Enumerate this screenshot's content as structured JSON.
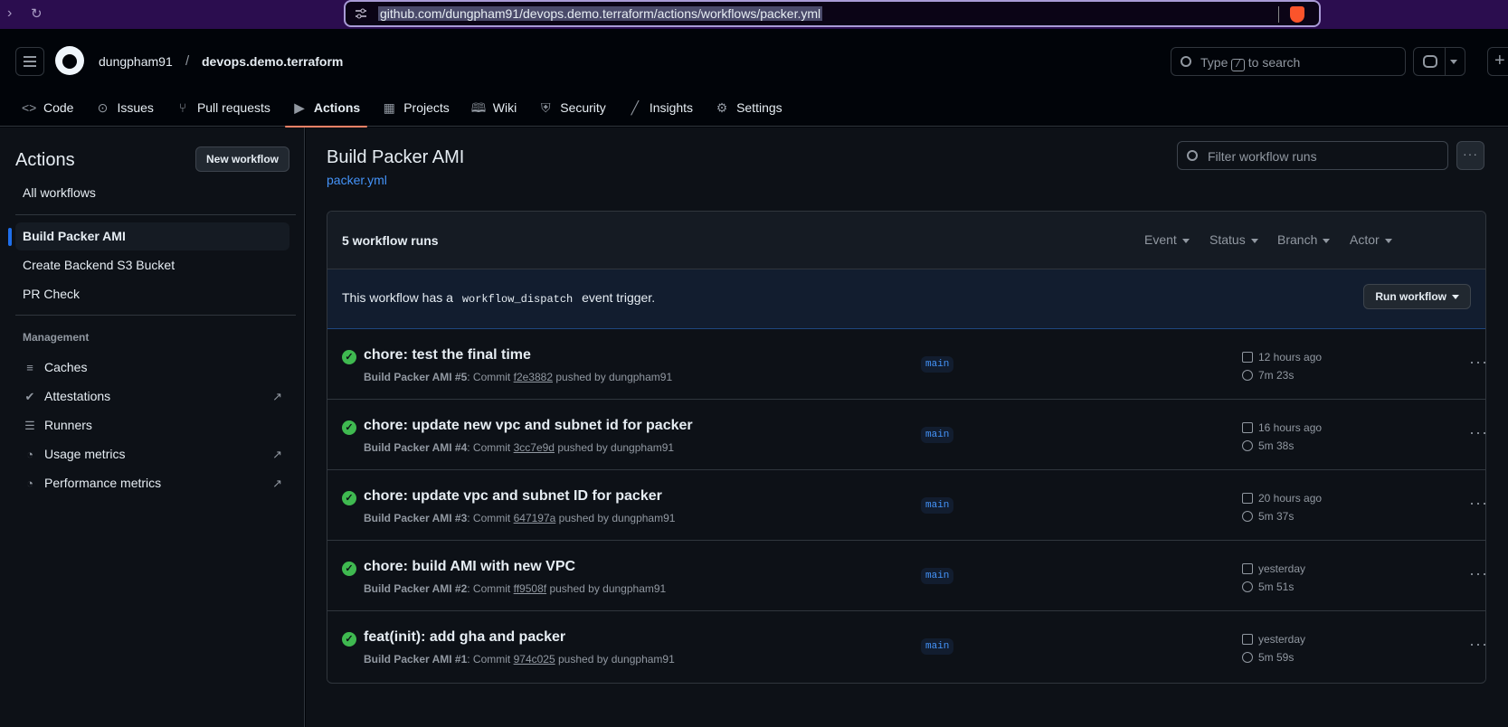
{
  "browser": {
    "url": "github.com/dungpham91/devops.demo.terraform/actions/workflows/packer.yml"
  },
  "header": {
    "owner": "dungpham91",
    "separator": "/",
    "repo": "devops.demo.terraform",
    "search_prefix": "Type",
    "search_key": "/",
    "search_suffix": "to search"
  },
  "tabs": [
    {
      "label": "Code",
      "icon": "code-icon"
    },
    {
      "label": "Issues",
      "icon": "issue-icon"
    },
    {
      "label": "Pull requests",
      "icon": "pull-request-icon"
    },
    {
      "label": "Actions",
      "icon": "play-icon",
      "active": true
    },
    {
      "label": "Projects",
      "icon": "table-icon"
    },
    {
      "label": "Wiki",
      "icon": "book-icon"
    },
    {
      "label": "Security",
      "icon": "shield-icon"
    },
    {
      "label": "Insights",
      "icon": "graph-icon"
    },
    {
      "label": "Settings",
      "icon": "gear-icon"
    }
  ],
  "sidebar": {
    "title": "Actions",
    "new_workflow": "New workflow",
    "all_workflows": "All workflows",
    "workflows": [
      "Build Packer AMI",
      "Create Backend S3 Bucket",
      "PR Check"
    ],
    "management_heading": "Management",
    "management": [
      {
        "label": "Caches",
        "icon": "database-icon",
        "external": false
      },
      {
        "label": "Attestations",
        "icon": "check-circle-icon",
        "external": true
      },
      {
        "label": "Runners",
        "icon": "server-icon",
        "external": false
      },
      {
        "label": "Usage metrics",
        "icon": "meter-icon",
        "external": true
      },
      {
        "label": "Performance metrics",
        "icon": "meter-icon",
        "external": true
      }
    ]
  },
  "main": {
    "title": "Build Packer AMI",
    "file": "packer.yml",
    "filter_placeholder": "Filter workflow runs",
    "run_count": "5 workflow runs",
    "filters": [
      "Event",
      "Status",
      "Branch",
      "Actor"
    ],
    "dispatch_prefix": "This workflow has a",
    "dispatch_code": "workflow_dispatch",
    "dispatch_suffix": "event trigger.",
    "run_workflow": "Run workflow",
    "runs": [
      {
        "title": "chore: test the final time",
        "workflow": "Build Packer AMI #5",
        "commit_label": ": Commit",
        "sha": "f2e3882",
        "pushed": "pushed by dungpham91",
        "branch": "main",
        "time": "12 hours ago",
        "duration": "7m 23s"
      },
      {
        "title": "chore: update new vpc and subnet id for packer",
        "workflow": "Build Packer AMI #4",
        "commit_label": ": Commit",
        "sha": "3cc7e9d",
        "pushed": "pushed by dungpham91",
        "branch": "main",
        "time": "16 hours ago",
        "duration": "5m 38s"
      },
      {
        "title": "chore: update vpc and subnet ID for packer",
        "workflow": "Build Packer AMI #3",
        "commit_label": ": Commit",
        "sha": "647197a",
        "pushed": "pushed by dungpham91",
        "branch": "main",
        "time": "20 hours ago",
        "duration": "5m 37s"
      },
      {
        "title": "chore: build AMI with new VPC",
        "workflow": "Build Packer AMI #2",
        "commit_label": ": Commit",
        "sha": "ff9508f",
        "pushed": "pushed by dungpham91",
        "branch": "main",
        "time": "yesterday",
        "duration": "5m 51s"
      },
      {
        "title": "feat(init): add gha and packer",
        "workflow": "Build Packer AMI #1",
        "commit_label": ": Commit",
        "sha": "974c025",
        "pushed": "pushed by dungpham91",
        "branch": "main",
        "time": "yesterday",
        "duration": "5m 59s"
      }
    ]
  }
}
